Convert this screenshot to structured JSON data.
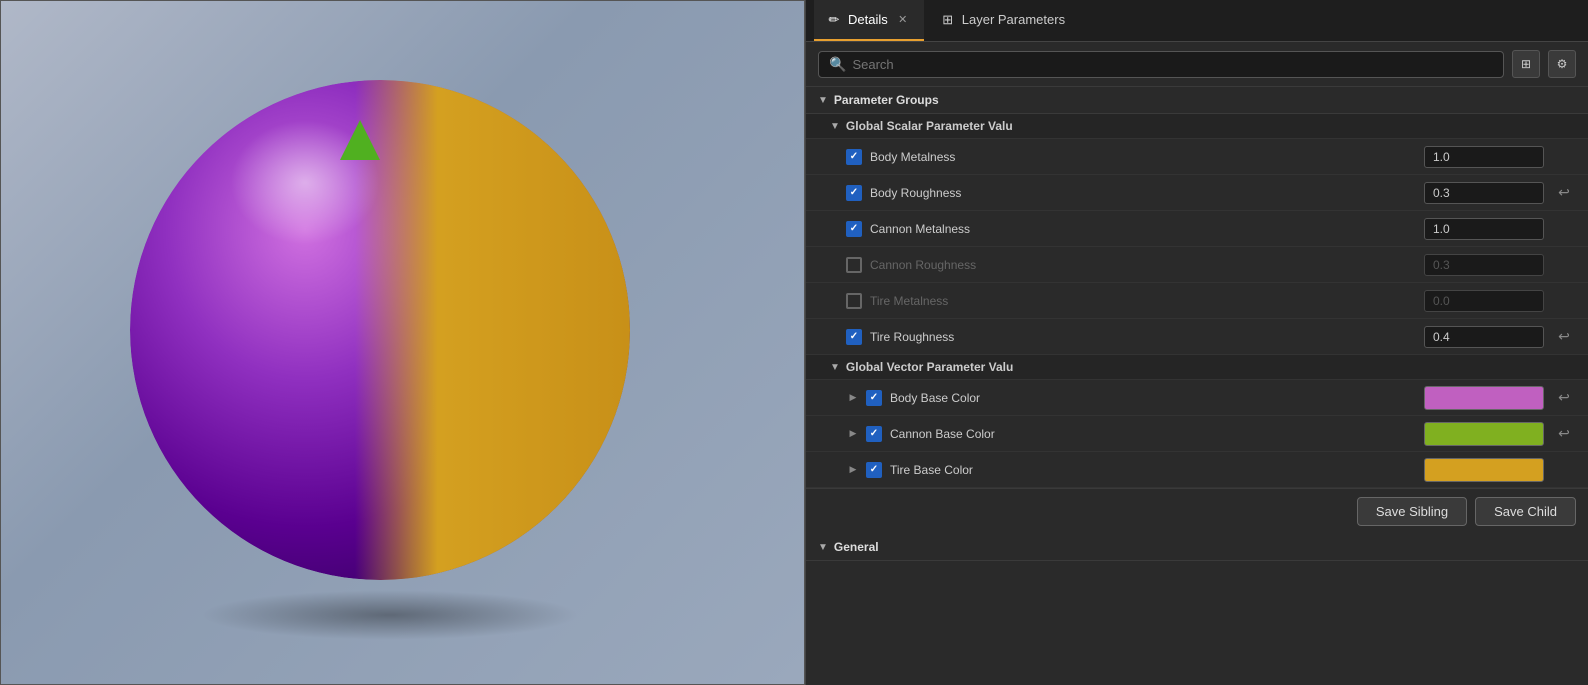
{
  "tabs": [
    {
      "id": "details",
      "label": "Details",
      "active": true,
      "icon": "pencil",
      "closable": true
    },
    {
      "id": "layer-params",
      "label": "Layer Parameters",
      "active": false,
      "icon": "layers",
      "closable": false
    }
  ],
  "search": {
    "placeholder": "Search"
  },
  "sections": {
    "parameter_groups": {
      "label": "Parameter Groups",
      "expanded": true,
      "subsections": [
        {
          "id": "global-scalar",
          "label": "Global Scalar Parameter Valu",
          "expanded": true,
          "params": [
            {
              "id": "body-metalness",
              "name": "Body Metalness",
              "checked": true,
              "value": "1.0",
              "disabled": false,
              "has_reset": false,
              "type": "scalar"
            },
            {
              "id": "body-roughness",
              "name": "Body Roughness",
              "checked": true,
              "value": "0.3",
              "disabled": false,
              "has_reset": true,
              "type": "scalar"
            },
            {
              "id": "cannon-metalness",
              "name": "Cannon Metalness",
              "checked": true,
              "value": "1.0",
              "disabled": false,
              "has_reset": false,
              "type": "scalar"
            },
            {
              "id": "cannon-roughness",
              "name": "Cannon Roughness",
              "checked": false,
              "value": "0.3",
              "disabled": true,
              "has_reset": false,
              "type": "scalar"
            },
            {
              "id": "tire-metalness",
              "name": "Tire Metalness",
              "checked": false,
              "value": "0.0",
              "disabled": true,
              "has_reset": false,
              "type": "scalar"
            },
            {
              "id": "tire-roughness",
              "name": "Tire Roughness",
              "checked": true,
              "value": "0.4",
              "disabled": false,
              "has_reset": true,
              "type": "scalar"
            }
          ]
        },
        {
          "id": "global-vector",
          "label": "Global Vector Parameter Valu",
          "expanded": true,
          "params": [
            {
              "id": "body-base-color",
              "name": "Body Base Color",
              "checked": true,
              "value": "",
              "disabled": false,
              "has_reset": true,
              "type": "color",
              "color": "#c060c0",
              "has_expand": true
            },
            {
              "id": "cannon-base-color",
              "name": "Cannon Base Color",
              "checked": true,
              "value": "",
              "disabled": false,
              "has_reset": true,
              "type": "color",
              "color": "#80b020",
              "has_expand": true
            },
            {
              "id": "tire-base-color",
              "name": "Tire Base Color",
              "checked": true,
              "value": "",
              "disabled": false,
              "has_reset": false,
              "type": "color",
              "color": "#d4a020",
              "has_expand": true
            }
          ]
        }
      ]
    },
    "general": {
      "label": "General"
    }
  },
  "actions": {
    "save_sibling": "Save Sibling",
    "save_child": "Save Child"
  }
}
